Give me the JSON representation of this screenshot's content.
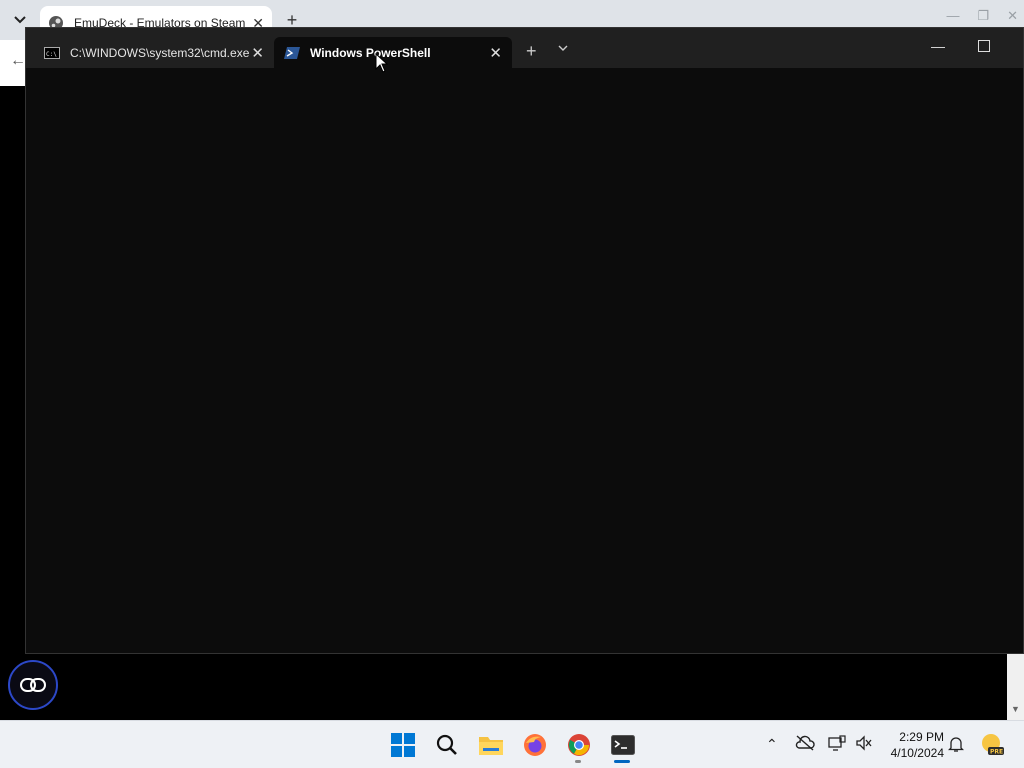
{
  "chrome": {
    "tab_title": "EmuDeck - Emulators on Steam"
  },
  "terminal": {
    "tabs": [
      {
        "label": "C:\\WINDOWS\\system32\\cmd.exe",
        "active": false
      },
      {
        "label": "Windows PowerShell",
        "active": true
      }
    ],
    "new_tab": "+",
    "dropdown": "⌄"
  },
  "taskbar": {
    "apps": [
      "start-icon",
      "search-icon",
      "file-explorer-icon",
      "firefox-icon",
      "chrome-icon",
      "terminal-icon"
    ],
    "clock": {
      "time": "2:29 PM",
      "date": "4/10/2024"
    }
  },
  "colors": {
    "terminal_bg": "#0c0c0c",
    "terminal_titlebar": "#202020",
    "taskbar_bg": "#eef1f5",
    "accent": "#0067c0"
  }
}
